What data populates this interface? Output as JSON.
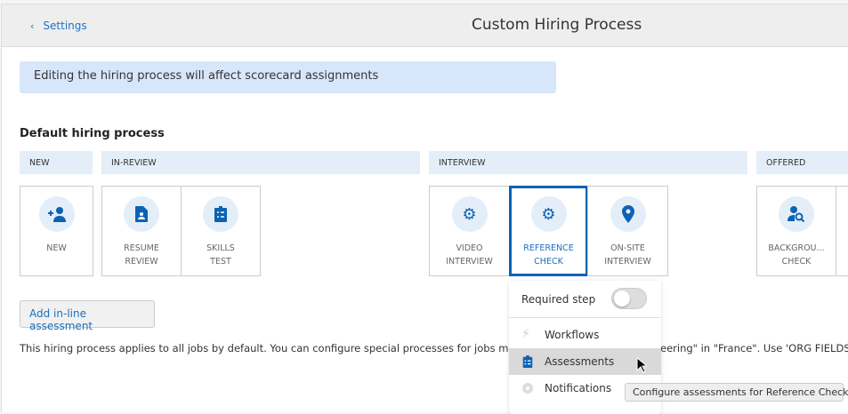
{
  "header": {
    "back_label": "Settings",
    "title": "Custom Hiring Process"
  },
  "banner": "Editing the hiring process will affect scorecard assignments",
  "section_title": "Default hiring process",
  "stages": [
    "NEW",
    "IN-REVIEW",
    "INTERVIEW",
    "OFFERED"
  ],
  "steps": [
    {
      "label": "NEW",
      "icon": "person-add-icon"
    },
    {
      "label": "RESUME\nREVIEW",
      "icon": "resume-icon"
    },
    {
      "label": "SKILLS\nTEST",
      "icon": "clipboard-list-icon"
    },
    {
      "label": "VIDEO\nINTERVIEW",
      "icon": "gear-icon"
    },
    {
      "label": "REFERENCE\nCHECK",
      "icon": "gear-icon",
      "selected": true
    },
    {
      "label": "ON-SITE\nINTERVIEW",
      "icon": "location-pin-icon"
    },
    {
      "label": "BACKGROU...\nCHECK",
      "icon": "person-search-icon"
    }
  ],
  "add_button": "Add in-line assessment",
  "description_start": "This hiring process applies to all jobs by default. You can configure special processes for jobs matc",
  "description_end": "eering\" in \"France\". Use 'ORG FIELDS' t",
  "menu": {
    "required_label": "Required step",
    "required_on": false,
    "items": [
      "Workflows",
      "Assessments",
      "Notifications"
    ],
    "highlighted": "Assessments"
  },
  "tooltip": "Configure assessments for Reference Check",
  "colors": {
    "accent": "#0b63b4",
    "banner": "#d8e6fc",
    "stage": "#e4eef8"
  }
}
